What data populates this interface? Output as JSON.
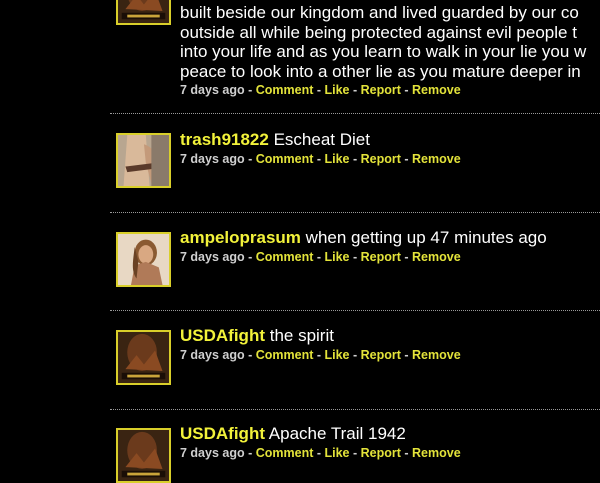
{
  "posts": [
    {
      "lines": [
        "built beside our kingdom and lived guarded by our co",
        "outside all while being protected against evil people t",
        "into your life and as you learn to walk in your lie you w",
        "peace to look into a other lie as you mature deeper in"
      ],
      "avatar_icon": "warrior-poster-icon",
      "meta": {
        "time": "7 days ago",
        "sep": " - ",
        "comment": "Comment",
        "like": "Like",
        "report": "Report",
        "remove": "Remove"
      }
    },
    {
      "username": "trash91822",
      "message": "Escheat Diet",
      "avatar_icon": "torso-photo-icon",
      "meta": {
        "time": "7 days ago",
        "sep": " - ",
        "comment": "Comment",
        "like": "Like",
        "report": "Report",
        "remove": "Remove"
      }
    },
    {
      "username": "ampeloprasum",
      "message": "when getting up 47 minutes ago",
      "avatar_icon": "woman-portrait-icon",
      "meta": {
        "time": "7 days ago",
        "sep": " - ",
        "comment": "Comment",
        "like": "Like",
        "report": "Report",
        "remove": "Remove"
      }
    },
    {
      "username": "USDAfight",
      "message": "the spirit",
      "avatar_icon": "warrior-poster-icon",
      "meta": {
        "time": "7 days ago",
        "sep": " - ",
        "comment": "Comment",
        "like": "Like",
        "report": "Report",
        "remove": "Remove"
      }
    },
    {
      "username": "USDAfight",
      "message": "Apache Trail 1942",
      "avatar_icon": "warrior-poster-icon",
      "meta": {
        "time": "7 days ago",
        "sep": " - ",
        "comment": "Comment",
        "like": "Like",
        "report": "Report",
        "remove": "Remove"
      }
    }
  ],
  "colors": {
    "background": "#000000",
    "username": "#f2f23a",
    "action_link": "#e3e33a",
    "avatar_border": "#d9cf2a"
  }
}
